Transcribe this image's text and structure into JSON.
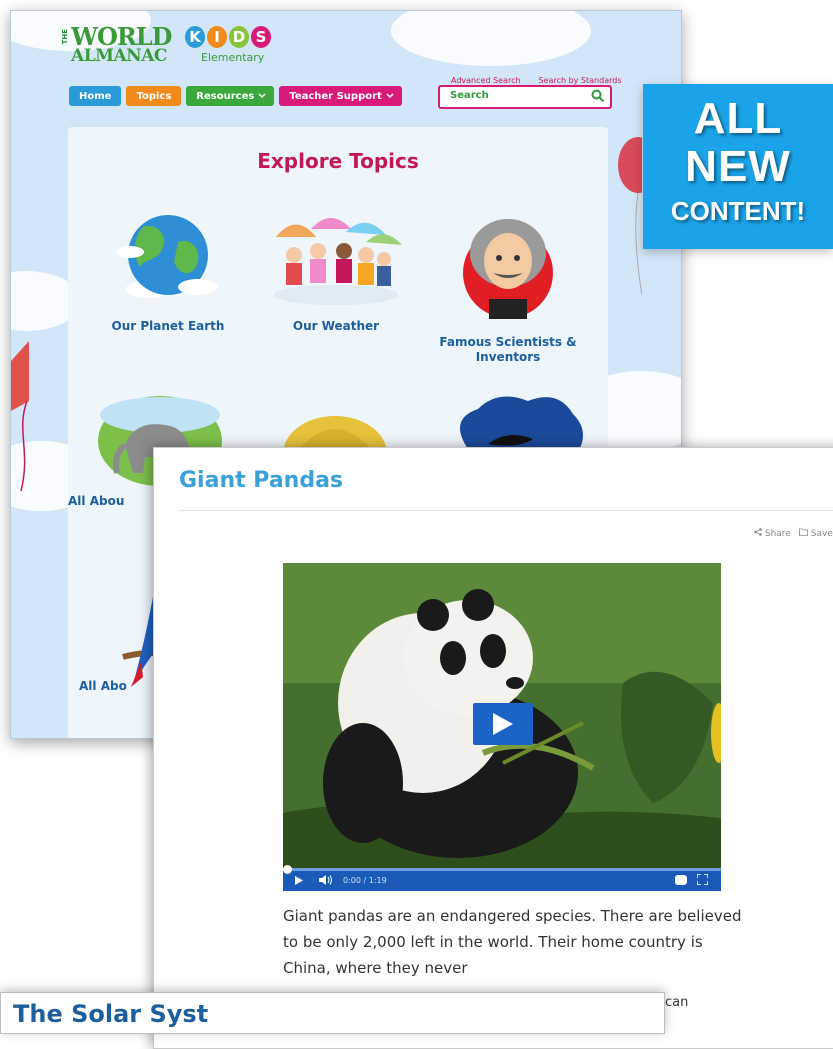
{
  "site": {
    "logo": {
      "the": "THE",
      "world": "WORLD",
      "almanac": "ALMANAC",
      "kids_letters": [
        "K",
        "I",
        "D",
        "S"
      ],
      "kids_colors": [
        "#2a9ad8",
        "#f08a1a",
        "#8ac43a",
        "#d81b7a"
      ],
      "elementary": "Elementary"
    },
    "nav": [
      {
        "label": "Home",
        "color": "#2a9ad8"
      },
      {
        "label": "Topics",
        "color": "#f08a1a"
      },
      {
        "label": "Resources",
        "color": "#3aa83a",
        "dropdown": true
      },
      {
        "label": "Teacher Support",
        "color": "#d81b7a",
        "dropdown": true
      }
    ],
    "advanced_search": "Advanced Search",
    "search_by_standards": "Search by Standards",
    "search_placeholder": "Search",
    "search_icon": "search-icon"
  },
  "explore": {
    "title": "Explore Topics",
    "topics": [
      {
        "label": "Our Planet Earth",
        "icon": "globe-icon"
      },
      {
        "label": "Our Weather",
        "icon": "kids-umbrellas-icon"
      },
      {
        "label_line1": "Famous Scientists &",
        "label_line2": "Inventors",
        "icon": "scientist-icon"
      },
      {
        "label": "All Abou",
        "icon": "elephant-icon"
      },
      {
        "label": "",
        "icon": "turtle-icon"
      },
      {
        "label": "",
        "icon": "orca-icon"
      },
      {
        "label": "All Abo",
        "icon": "parrot-icon"
      }
    ]
  },
  "article": {
    "title": "Giant Pandas",
    "share_label": "Share",
    "save_label": "Save",
    "video_time": "0:00 / 1:19",
    "paragraph": "Giant pandas are an endangered species. There are believed to be only 2,000 left in the world. Their home country is China, where they never",
    "trailing": "can"
  },
  "bottom_window": {
    "title_partial": "The Solar Syst"
  },
  "badge": {
    "line1": "ALL",
    "line2": "NEW",
    "line3": "CONTENT!",
    "color": "#1aa3e8"
  }
}
